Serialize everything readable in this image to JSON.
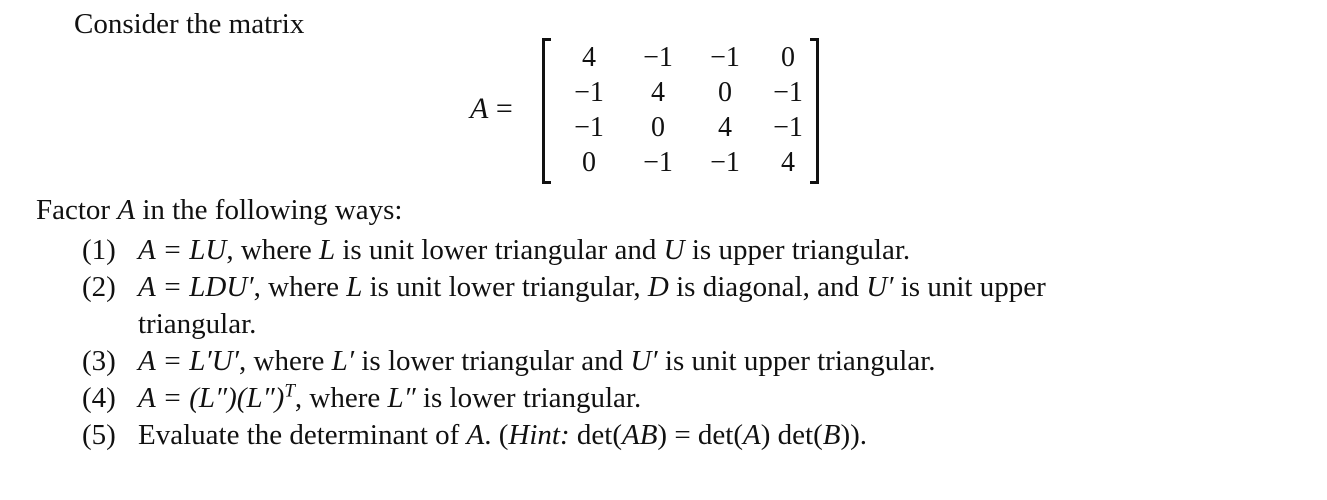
{
  "intro": "Consider the matrix",
  "matrix": {
    "name": "A",
    "equals": "=",
    "rows": [
      [
        "4",
        "−1",
        "−1",
        "0"
      ],
      [
        "−1",
        "4",
        "0",
        "−1"
      ],
      [
        "−1",
        "0",
        "4",
        "−1"
      ],
      [
        "0",
        "−1",
        "−1",
        "4"
      ]
    ]
  },
  "lead": {
    "before": "Factor ",
    "var": "A",
    "after": " in the following ways:"
  },
  "items": [
    {
      "num": "(1)",
      "parts": [
        {
          "t": "A = LU",
          "style": "math"
        },
        {
          "t": ", where ",
          "style": "text"
        },
        {
          "t": "L",
          "style": "math"
        },
        {
          "t": " is unit lower triangular and ",
          "style": "text"
        },
        {
          "t": "U",
          "style": "math"
        },
        {
          "t": " is upper triangular.",
          "style": "text"
        }
      ]
    },
    {
      "num": "(2)",
      "parts": [
        {
          "t": "A = LDU′",
          "style": "math"
        },
        {
          "t": ", where ",
          "style": "text"
        },
        {
          "t": "L",
          "style": "math"
        },
        {
          "t": " is unit lower triangular, ",
          "style": "text"
        },
        {
          "t": "D",
          "style": "math"
        },
        {
          "t": " is diagonal, and ",
          "style": "text"
        },
        {
          "t": "U′",
          "style": "math"
        },
        {
          "t": " is unit upper",
          "style": "text"
        }
      ],
      "continuation": "triangular."
    },
    {
      "num": "(3)",
      "parts": [
        {
          "t": "A = L′U′",
          "style": "math"
        },
        {
          "t": ", where ",
          "style": "text"
        },
        {
          "t": "L′",
          "style": "math"
        },
        {
          "t": " is lower triangular and ",
          "style": "text"
        },
        {
          "t": "U′",
          "style": "math"
        },
        {
          "t": " is unit upper triangular.",
          "style": "text"
        }
      ]
    },
    {
      "num": "(4)",
      "parts": [
        {
          "t": "A = (L″)(L″)",
          "style": "math"
        },
        {
          "t": "T",
          "style": "sup"
        },
        {
          "t": ", where ",
          "style": "text"
        },
        {
          "t": "L″",
          "style": "math"
        },
        {
          "t": " is lower triangular.",
          "style": "text"
        }
      ]
    },
    {
      "num": "(5)",
      "parts": [
        {
          "t": "Evaluate the determinant of ",
          "style": "text"
        },
        {
          "t": "A",
          "style": "math"
        },
        {
          "t": ". (",
          "style": "text"
        },
        {
          "t": "Hint:",
          "style": "math"
        },
        {
          "t": " det(",
          "style": "text"
        },
        {
          "t": "AB",
          "style": "math"
        },
        {
          "t": ") = det(",
          "style": "text"
        },
        {
          "t": "A",
          "style": "math"
        },
        {
          "t": ") det(",
          "style": "text"
        },
        {
          "t": "B",
          "style": "math"
        },
        {
          "t": ")).",
          "style": "text"
        }
      ]
    }
  ]
}
